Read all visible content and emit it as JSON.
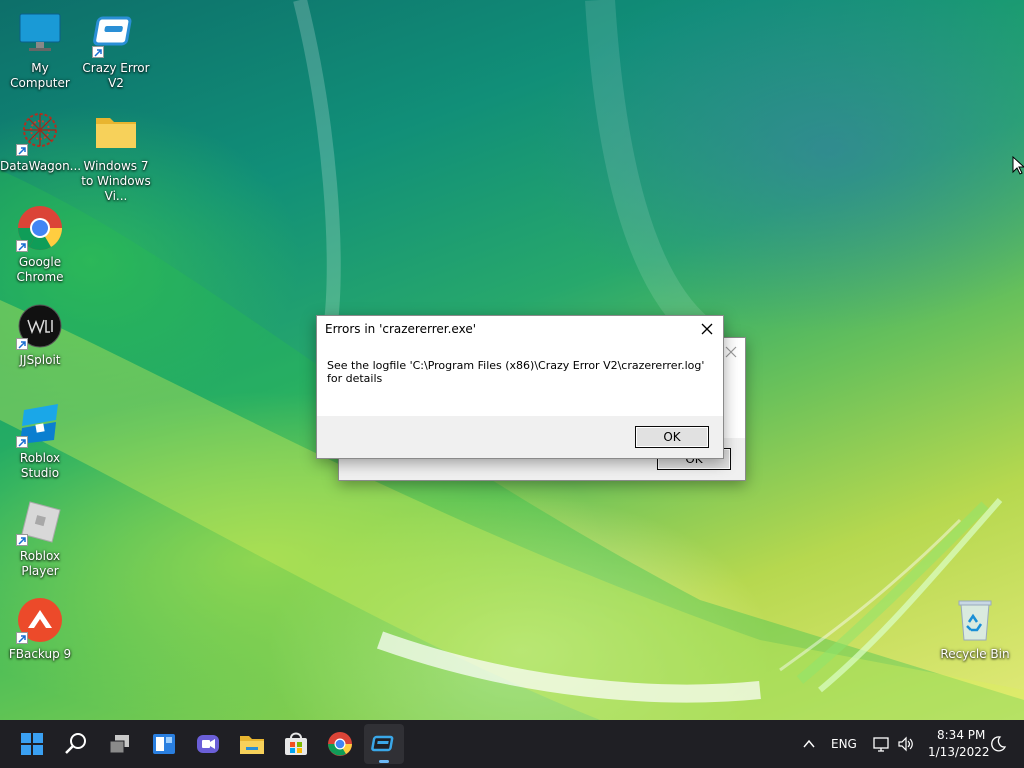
{
  "desktop": {
    "icons": [
      {
        "label": "My Computer",
        "icon": "monitor-icon"
      },
      {
        "label": "Crazy Error V2",
        "icon": "crazy-error-icon"
      },
      {
        "label": "DataWagon...",
        "icon": "datawagon-icon"
      },
      {
        "label": "Windows 7 to Windows Vi...",
        "icon": "folder-icon"
      },
      {
        "label": "Google Chrome",
        "icon": "chrome-icon"
      },
      {
        "label": "JJSploit",
        "icon": "jjsploit-icon"
      },
      {
        "label": "Roblox Studio",
        "icon": "roblox-studio-icon"
      },
      {
        "label": "Roblox Player",
        "icon": "roblox-player-icon"
      },
      {
        "label": "FBackup 9",
        "icon": "fbackup-icon"
      },
      {
        "label": "Recycle Bin",
        "icon": "recycle-bin-icon"
      }
    ]
  },
  "dialog": {
    "title": "Errors in 'crazererrer.exe'",
    "message": "See the logfile 'C:\\Program Files (x86)\\Crazy Error V2\\crazererrer.log' for details",
    "ok_label": "OK"
  },
  "back_dialog": {
    "ok_label": "OK"
  },
  "taskbar": {
    "apps": [
      "start-icon",
      "search-icon",
      "task-view-icon",
      "widgets-icon",
      "chat-icon",
      "file-explorer-icon",
      "store-icon",
      "chrome-icon",
      "crazy-error-icon"
    ],
    "language": "ENG",
    "time": "8:34 PM",
    "date": "1/13/2022"
  },
  "colors": {
    "taskbar_bg": "#1f1f24",
    "accent": "#0078d4"
  }
}
